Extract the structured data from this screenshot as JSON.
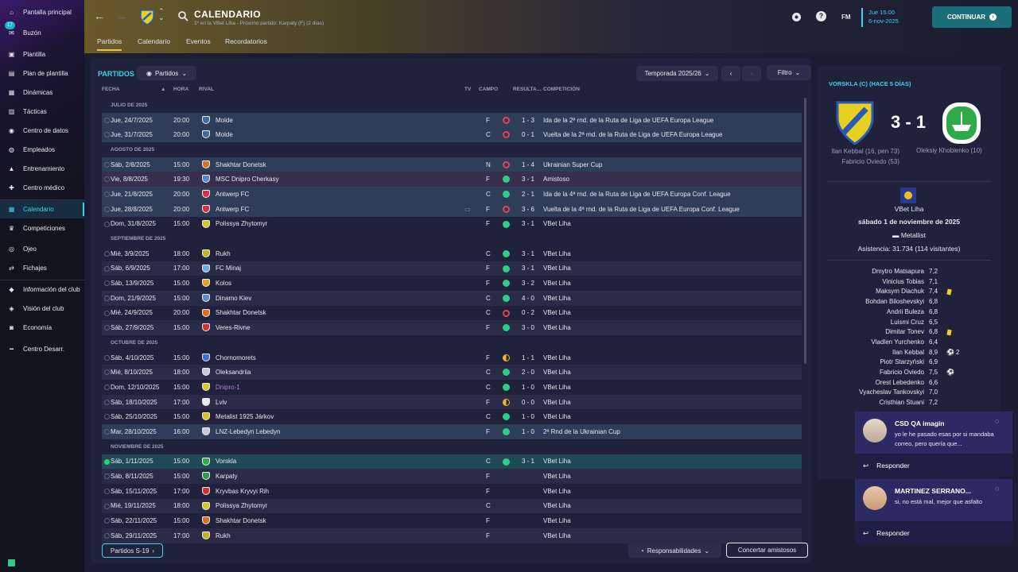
{
  "sidebar": {
    "badge": "17",
    "items": [
      {
        "label": "Pantalla principal",
        "icon": "home-icon"
      },
      {
        "label": "Buzón",
        "icon": "inbox-icon"
      },
      {
        "label": "Plantilla",
        "icon": "shirt-icon"
      },
      {
        "label": "Plan de plantilla",
        "icon": "clipboard-icon"
      },
      {
        "label": "Dinámicas",
        "icon": "dynamics-icon"
      },
      {
        "label": "Tácticas",
        "icon": "tactics-icon"
      },
      {
        "label": "Centro de datos",
        "icon": "data-icon"
      },
      {
        "label": "Empleados",
        "icon": "staff-icon"
      },
      {
        "label": "Entrenamiento",
        "icon": "training-icon"
      },
      {
        "label": "Centro médico",
        "icon": "medical-icon"
      },
      {
        "label": "Calendario",
        "icon": "calendar-icon"
      },
      {
        "label": "Competiciones",
        "icon": "trophy-icon"
      },
      {
        "label": "Ojeo",
        "icon": "scouting-icon"
      },
      {
        "label": "Fichajes",
        "icon": "transfer-icon"
      },
      {
        "label": "Información del club",
        "icon": "club-info-icon"
      },
      {
        "label": "Visión del club",
        "icon": "vision-icon"
      },
      {
        "label": "Economía",
        "icon": "finance-icon"
      },
      {
        "label": "Centro Desarr.",
        "icon": "development-icon"
      }
    ]
  },
  "header": {
    "title": "CALENDARIO",
    "subtitle": "1º en la VBet Liha - Próximo partido: Karpaty (F)  (2 días)",
    "tabs": [
      "Partidos",
      "Calendario",
      "Eventos",
      "Recordatorios"
    ],
    "fm": "FM",
    "time": "Jue 15:00",
    "date": "6-nov-2025",
    "continue": "CONTINUAR"
  },
  "main": {
    "title": "PARTIDOS",
    "view": "Partidos",
    "season": "Temporada 2025/26",
    "filter": "Filtro",
    "cols": {
      "date": "FECHA",
      "time": "HORA",
      "opp": "RIVAL",
      "tv": "TV",
      "field": "CAMPO",
      "res": "RESULTA...",
      "comp": "COMPETICIÓN"
    },
    "rows": [
      {
        "m": "JULIO DE 2025"
      },
      {
        "d": "Jue, 24/7/2025",
        "t": "20:00",
        "o": "Molde",
        "f": "F",
        "r": "1 - 3",
        "c": "Ida de la 2ª rnd. de la Ruta de Liga de UEFA Europa League",
        "s": "l",
        "k": "cup",
        "cc": "#3a6ea5"
      },
      {
        "d": "Jue, 31/7/2025",
        "t": "20:00",
        "o": "Molde",
        "f": "C",
        "r": "0 - 1",
        "c": "Vuelta de la 2ª rnd. de la Ruta de Liga de UEFA Europa League",
        "s": "l",
        "k": "cup",
        "cc": "#3a6ea5"
      },
      {
        "m": "AGOSTO DE 2025"
      },
      {
        "d": "Sáb, 2/8/2025",
        "t": "15:00",
        "o": "Shakhtar Donetsk",
        "f": "N",
        "r": "1 - 4",
        "c": "Ukrainian Super Cup",
        "s": "l",
        "k": "cup",
        "cc": "#e07020"
      },
      {
        "d": "Vie, 8/8/2025",
        "t": "19:30",
        "o": "MSC Dnipro Cherkasy",
        "f": "F",
        "r": "3 - 1",
        "c": "Amistoso",
        "s": "w",
        "k": "fr",
        "cc": "#4a8ad8"
      },
      {
        "d": "Jue, 21/8/2025",
        "t": "20:00",
        "o": "Antwerp FC",
        "f": "C",
        "r": "2 - 1",
        "c": "Ida de la 4ª rnd. de la Ruta de Liga de UEFA Europa Conf. League",
        "s": "w",
        "k": "cup",
        "cc": "#d83040"
      },
      {
        "d": "Jue, 28/8/2025",
        "t": "20:00",
        "o": "Antwerp FC",
        "tv": "▭",
        "f": "F",
        "r": "3 - 6",
        "c": "Vuelta de la 4ª rnd. de la Ruta de Liga de UEFA Europa Conf. League",
        "s": "l",
        "k": "cup",
        "cc": "#d83040"
      },
      {
        "d": "Dom, 31/8/2025",
        "t": "15:00",
        "o": "Polissya Zhytomyr",
        "f": "F",
        "r": "3 - 1",
        "c": "VBet Liha",
        "s": "w",
        "k": "",
        "cc": "#d8c820"
      },
      {
        "m": "SEPTIEMBRE DE 2025"
      },
      {
        "d": "Mié, 3/9/2025",
        "t": "18:00",
        "o": "Rukh",
        "f": "C",
        "r": "3 - 1",
        "c": "VBet Liha",
        "s": "w",
        "k": "",
        "cc": "#c8b020"
      },
      {
        "d": "Sáb, 6/9/2025",
        "t": "17:00",
        "o": "FC Minaj",
        "f": "F",
        "r": "3 - 1",
        "c": "VBet Liha",
        "s": "w",
        "k": "alt",
        "cc": "#6aaee8"
      },
      {
        "d": "Sáb, 13/9/2025",
        "t": "15:00",
        "o": "Kolos",
        "f": "F",
        "r": "3 - 2",
        "c": "VBet Liha",
        "s": "w",
        "k": "",
        "cc": "#e0a020"
      },
      {
        "d": "Dom, 21/9/2025",
        "t": "15:00",
        "o": "Dinamo Kiev",
        "f": "C",
        "r": "4 - 0",
        "c": "VBet Liha",
        "s": "w",
        "k": "alt",
        "cc": "#5a8ed8"
      },
      {
        "d": "Mié, 24/9/2025",
        "t": "20:00",
        "o": "Shakhtar Donetsk",
        "f": "C",
        "r": "0 - 2",
        "c": "VBet Liha",
        "s": "l",
        "k": "",
        "cc": "#e07020"
      },
      {
        "d": "Sáb, 27/9/2025",
        "t": "15:00",
        "o": "Veres-Rivne",
        "f": "F",
        "r": "3 - 0",
        "c": "VBet Liha",
        "s": "w",
        "k": "alt",
        "cc": "#d83030"
      },
      {
        "m": "OCTUBRE DE 2025"
      },
      {
        "d": "Sáb, 4/10/2025",
        "t": "15:00",
        "o": "Chornomorets",
        "f": "F",
        "r": "1 - 1",
        "c": "VBet Liha",
        "s": "d",
        "k": "",
        "cc": "#3a6ed8"
      },
      {
        "d": "Mié, 8/10/2025",
        "t": "18:00",
        "o": "Oleksandriia",
        "f": "C",
        "r": "2 - 0",
        "c": "VBet Liha",
        "s": "w",
        "k": "alt",
        "cc": "#c8c8d8"
      },
      {
        "d": "Dom, 12/10/2025",
        "t": "15:00",
        "o": "Dnipro-1",
        "hl": true,
        "f": "C",
        "r": "1 - 0",
        "c": "VBet Liha",
        "s": "w",
        "k": "",
        "cc": "#d8c820"
      },
      {
        "d": "Sáb, 18/10/2025",
        "t": "17:00",
        "o": "Lviv",
        "f": "F",
        "r": "0 - 0",
        "c": "VBet Liha",
        "s": "d",
        "k": "alt",
        "cc": "#e8e8f0"
      },
      {
        "d": "Sáb, 25/10/2025",
        "t": "15:00",
        "o": "Metalist 1925 Járkov",
        "f": "C",
        "r": "1 - 0",
        "c": "VBet Liha",
        "s": "w",
        "k": "",
        "cc": "#d8c020"
      },
      {
        "d": "Mar, 28/10/2025",
        "t": "16:00",
        "o": "LNZ-Lebedyn Lebedyn",
        "f": "F",
        "r": "1 - 0",
        "c": "2ª Rnd de la Ukrainian Cup",
        "s": "w",
        "k": "cup",
        "cc": "#c8c8d8"
      },
      {
        "m": "NOVIEMBRE DE 2025"
      },
      {
        "d": "Sáb, 1/11/2025",
        "t": "15:00",
        "o": "Vorskla",
        "f": "C",
        "r": "3 - 1",
        "c": "VBet Liha",
        "s": "w",
        "k": "sel",
        "cc": "#2eaa4a"
      },
      {
        "d": "Sáb, 8/11/2025",
        "t": "15:00",
        "o": "Karpaty",
        "f": "F",
        "r": "",
        "c": "VBet Liha",
        "s": "",
        "k": "alt",
        "cc": "#2e9a4a"
      },
      {
        "d": "Sáb, 15/11/2025",
        "t": "17:00",
        "o": "Kryvbas Kryvyi Rih",
        "f": "F",
        "r": "",
        "c": "VBet Liha",
        "s": "",
        "k": "",
        "cc": "#d83030"
      },
      {
        "d": "Mié, 19/11/2025",
        "t": "18:00",
        "o": "Polissya Zhytomyr",
        "f": "C",
        "r": "",
        "c": "VBet Liha",
        "s": "",
        "k": "alt",
        "cc": "#d8c820"
      },
      {
        "d": "Sáb, 22/11/2025",
        "t": "15:00",
        "o": "Shakhtar Donetsk",
        "f": "F",
        "r": "",
        "c": "VBet Liha",
        "s": "",
        "k": "",
        "cc": "#e07020"
      },
      {
        "d": "Sáb, 29/11/2025",
        "t": "17:00",
        "o": "Rukh",
        "f": "F",
        "r": "",
        "c": "VBet Liha",
        "s": "",
        "k": "alt",
        "cc": "#c8b020"
      }
    ],
    "u19": "Partidos S-19",
    "resp": "Responsabilidades",
    "arrange": "Concertar amistosos"
  },
  "match": {
    "heading": "VORSKLA (C)  (HACE 5 DÍAS)",
    "score": "3 - 1",
    "home_scorers": "Ilan Kebbal (16, pen 73)\nFabricio Oviedo (53)",
    "away_scorers": "Oleksiy Khoblenko (10)",
    "competition": "VBet Liha",
    "date": "sábado 1 de noviembre de 2025",
    "stadium": "Metallist",
    "attendance": "Asistencia: 31.734 (114 visitantes)",
    "players": [
      {
        "n": "Dmytro Matsapura",
        "r": "7,2"
      },
      {
        "n": "Vinicius Tobias",
        "r": "7,1"
      },
      {
        "n": "Maksym Diachuk",
        "r": "7,4",
        "e": "y"
      },
      {
        "n": "Bohdan Biloshevskyi",
        "r": "6,8"
      },
      {
        "n": "Andrii Buleza",
        "r": "6,8"
      },
      {
        "n": "Luismi Cruz",
        "r": "6,5"
      },
      {
        "n": "Dimitar Tonev",
        "r": "6,8",
        "e": "y"
      },
      {
        "n": "Vladlen Yurchenko",
        "r": "6,4"
      },
      {
        "n": "Ilan Kebbal",
        "r": "8,9",
        "e": "g",
        "x": "2"
      },
      {
        "n": "Piotr Starzyński",
        "r": "6,9"
      },
      {
        "n": "Fabricio Oviedo",
        "r": "7,5",
        "e": "g"
      },
      {
        "n": "Orest Lebedenko",
        "r": "6,6"
      },
      {
        "n": "Vyacheslav Tankovskyi",
        "r": "7,0"
      },
      {
        "n": "Cristhian Stuani",
        "r": "7,2"
      }
    ]
  },
  "notifications": [
    {
      "name": "CSD QA imagin",
      "msg": "yo le he pasado esas por si mandaba correo, pero quería que...",
      "reply": "Responder"
    },
    {
      "name": "MARTINEZ SERRANO...",
      "msg": "si, no está mal, mejor que asfalto",
      "reply": "Responder"
    }
  ]
}
